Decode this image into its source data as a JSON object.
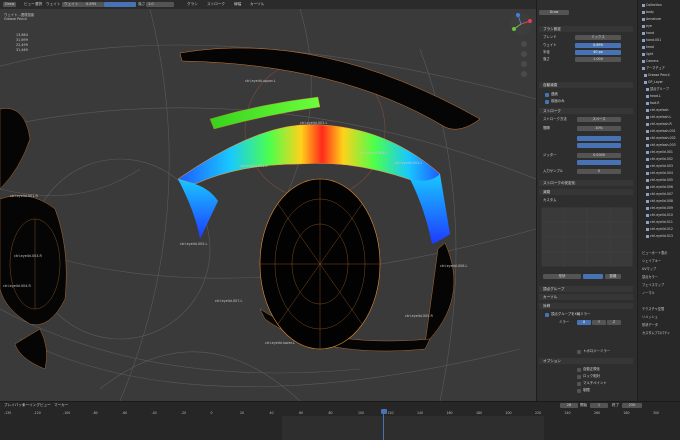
{
  "topbar": {
    "mode": "Draw",
    "items": [
      "ビュー",
      "選択",
      "ウェイト"
    ],
    "brush": "ウェイト",
    "value": "0.895",
    "strength_label": "強さ",
    "strength": "1.0",
    "menus": [
      "グラシ",
      "ストローク",
      "線幅",
      "カーソル"
    ]
  },
  "viewport": {
    "stats_title": "ウェイト...透視投影",
    "stats_sub": "Grease Pencil",
    "stats": [
      "13,864",
      "31,699",
      "22,499",
      "31,469"
    ],
    "labels": [
      "ctrl.eyelid.upper.L",
      "ctrl.eyelid.001.L",
      "ctrl.eyelid.002.L",
      "ctrl.eyelid.003.L",
      "ctrl.eyelid.004.L",
      "ctrl.eyelid.005.L",
      "ctrl.eyelid.006.L",
      "ctrl.eyelid.007.L",
      "ctrl.eyelid.lower.L",
      "ctrl.eyelid.001.R",
      "ctrl.eyelid.003.R",
      "ctrl.eyelid.004.R",
      "ctrl.eyelid.005.R"
    ],
    "icons": [
      "zoom-icon",
      "hand-icon",
      "camera-icon",
      "grid-icon"
    ]
  },
  "properties": {
    "tool": "Draw",
    "section_brush": "ブラシ設定",
    "blend_label": "ブレンド",
    "blend_value": "ミックス",
    "weight_label": "ウェイト",
    "weight_value": "0.895",
    "radius_label": "半径",
    "radius_value": "40 px",
    "strength_label": "強さ",
    "strength_value": "1.000",
    "falloff": "自動減衰",
    "cb1": "連続",
    "cb2": "前面のみ",
    "section_stroke": "ストローク",
    "stroke_method_label": "ストローク方法",
    "stroke_method": "スペース",
    "spacing_label": "間隔",
    "spacing_value": "10%",
    "jitter_label": "ジッター",
    "jitter_value": "0.0000",
    "input_label": "入力サンプル",
    "input_value": "0",
    "stroke_smooth": "ストロークの安定化",
    "section_falloff": "減衰",
    "custom": "カスタム",
    "sub_labels": [
      "形状",
      "距離"
    ],
    "section_vg": "頂点グループ",
    "section_cursor": "カーソル",
    "section_symmetry": "対称",
    "mirror_label": "ミラー",
    "xyz": [
      "X",
      "Y",
      "Z"
    ],
    "vg_cb": "頂点グループをX軸ミラー",
    "topology": "トポロジーミラー",
    "section_options": "オプション",
    "opt": [
      "自動正規化",
      "ロック相対",
      "マルチペイント",
      "制限"
    ]
  },
  "outliner": {
    "rows": [
      "Collection",
      "body",
      "Armature",
      "eye",
      "hand",
      "hand.001",
      "head",
      "light",
      "Camera",
      "アーマチュア",
      "Grease Pencil",
      "GP_Layer",
      "頂点グループ",
      "head.L",
      "foot.R",
      "ctrl.eyelash",
      "ctrl.eyelash.L",
      "ctrl.eyelash.R",
      "ctrl.eyelash.001",
      "ctrl.eyelash.002",
      "ctrl.eyelash.003",
      "ctrl.eyelid.001",
      "ctrl.eyelid.002",
      "ctrl.eyelid.003",
      "ctrl.eyelid.004",
      "ctrl.eyelid.005",
      "ctrl.eyelid.006",
      "ctrl.eyelid.007",
      "ctrl.eyelid.008",
      "ctrl.eyelid.009",
      "ctrl.eyelid.010",
      "ctrl.eyelid.011",
      "ctrl.eyelid.012",
      "ctrl.eyelid.013"
    ],
    "section2": [
      "ビューポート表示",
      "シェイプキー",
      "UVマップ",
      "頂点カラー",
      "フェイスマップ",
      "ノーマル"
    ],
    "section3": [
      "テクスチャ空間",
      "リメッシュ",
      "形状データ",
      "カスタムプロパティ"
    ]
  },
  "timeline": {
    "menus": [
      "プレイバック",
      "キーイング",
      "ビュー",
      "マーカー"
    ],
    "frame": "28",
    "start_label": "開始",
    "start": "1",
    "end_label": "終了",
    "end": "250",
    "ticks": [
      "-130",
      "-120",
      "-100",
      "-80",
      "-60",
      "-40",
      "-20",
      "0",
      "20",
      "40",
      "60",
      "80",
      "100",
      "120",
      "140",
      "160",
      "180",
      "200",
      "220",
      "240",
      "260",
      "280",
      "300"
    ]
  },
  "colors": {
    "accent": "#4772b3",
    "bg": "#303030",
    "viewport": "#3a3a3a",
    "orange_wire": "#e8922e"
  }
}
